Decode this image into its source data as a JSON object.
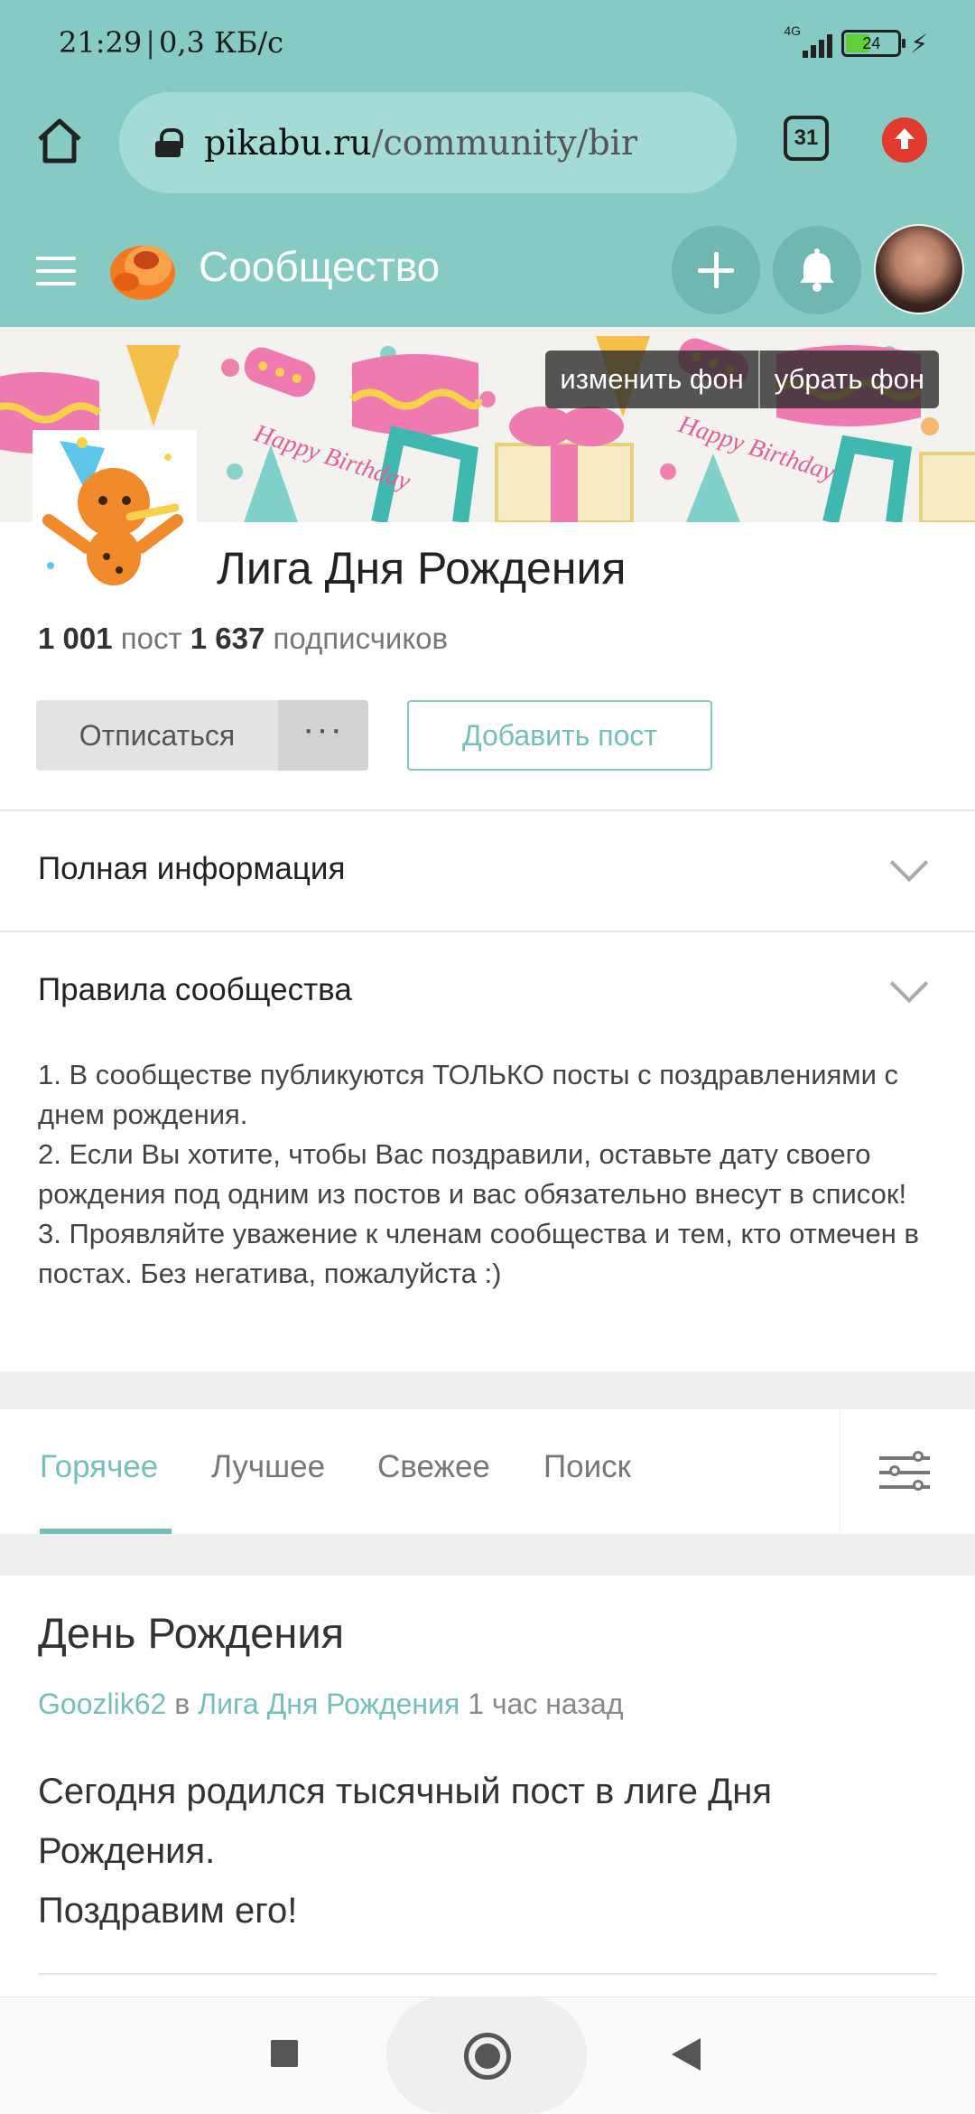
{
  "status_bar": {
    "time": "21:29",
    "speed": "0,3 КБ/с",
    "network": "4G",
    "battery": "24"
  },
  "browser": {
    "url_host": "pikabu.ru",
    "url_path": "/community/bir",
    "tabs_count": "31",
    "icons": [
      "home-icon",
      "lock-icon",
      "tabs-icon",
      "update-icon"
    ]
  },
  "site_header": {
    "title": "Сообщество",
    "icons": [
      "menu-icon",
      "pikabu-logo-icon",
      "plus-icon",
      "bell-icon",
      "avatar"
    ]
  },
  "banner": {
    "change_bg": "изменить фон",
    "remove_bg": "убрать фон",
    "art_text": "Happy Birthday"
  },
  "community": {
    "name": "Лига Дня Рождения",
    "posts_count": "1 001",
    "posts_label": "пост",
    "subscribers_count": "1 637",
    "subscribers_label": "подписчиков",
    "unsubscribe_label": "Отписаться",
    "more_label": "···",
    "add_post_label": "Добавить пост"
  },
  "sections": {
    "full_info": "Полная информация",
    "rules_title": "Правила сообщества",
    "rules": [
      "1. В сообществе публикуются ТОЛЬКО посты с поздравлениями с днем рождения.",
      "2. Если Вы хотите, чтобы Вас поздравили, оставьте дату своего рождения под одним из постов и вас обязательно внесут в список!",
      "3. Проявляйте уважение к членам сообщества и тем, кто отмечен в постах. Без негатива, пожалуйста :)"
    ]
  },
  "feed_tabs": {
    "items": [
      "Горячее",
      "Лучшее",
      "Свежее",
      "Поиск"
    ],
    "active": "Горячее"
  },
  "post": {
    "title": "День Рождения",
    "author": "Goozlik62",
    "in_word": "в",
    "community": "Лига Дня Рождения",
    "time": "1 час назад",
    "body": [
      "Сегодня родился тысячный пост в лиге Дня",
      "Рождения.",
      "Поздравим его!"
    ]
  },
  "colors": {
    "accent": "#85cac3",
    "link": "#74bfb8",
    "update_badge": "#e23b2e"
  }
}
